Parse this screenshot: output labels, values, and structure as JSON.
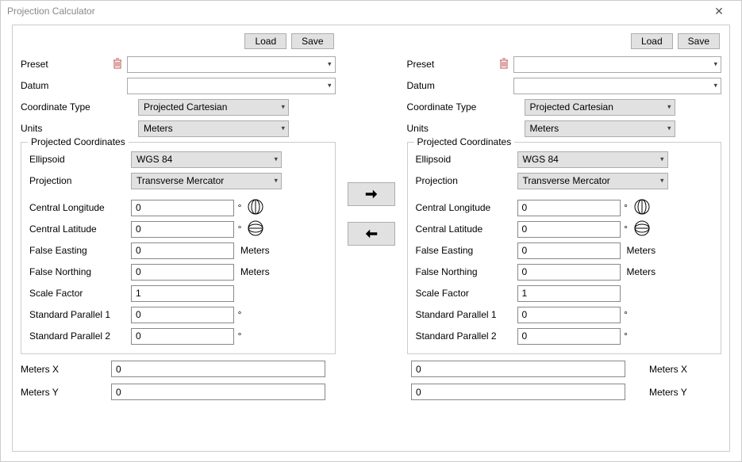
{
  "window": {
    "title": "Projection Calculator"
  },
  "buttons": {
    "load": "Load",
    "save": "Save"
  },
  "labels": {
    "preset": "Preset",
    "datum": "Datum",
    "coord_type": "Coordinate Type",
    "units": "Units",
    "group_title": "Projected Coordinates",
    "ellipsoid": "Ellipsoid",
    "projection": "Projection",
    "central_lon": "Central Longitude",
    "central_lat": "Central Latitude",
    "false_easting": "False Easting",
    "false_northing": "False Northing",
    "scale_factor": "Scale Factor",
    "sp1": "Standard Parallel 1",
    "sp2": "Standard Parallel 2",
    "unit_suffix": "Meters",
    "degree": "°",
    "meters_x": "Meters X",
    "meters_y": "Meters Y"
  },
  "left": {
    "preset": "",
    "datum": "",
    "coord_type": "Projected Cartesian",
    "units": "Meters",
    "ellipsoid": "WGS 84",
    "projection": "Transverse Mercator",
    "central_lon": "0",
    "central_lat": "0",
    "false_easting": "0",
    "false_northing": "0",
    "scale_factor": "1",
    "sp1": "0",
    "sp2": "0",
    "meters_x": "0",
    "meters_y": "0"
  },
  "right": {
    "preset": "",
    "datum": "",
    "coord_type": "Projected Cartesian",
    "units": "Meters",
    "ellipsoid": "WGS 84",
    "projection": "Transverse Mercator",
    "central_lon": "0",
    "central_lat": "0",
    "false_easting": "0",
    "false_northing": "0",
    "scale_factor": "1",
    "sp1": "0",
    "sp2": "0",
    "meters_x": "0",
    "meters_y": "0"
  }
}
